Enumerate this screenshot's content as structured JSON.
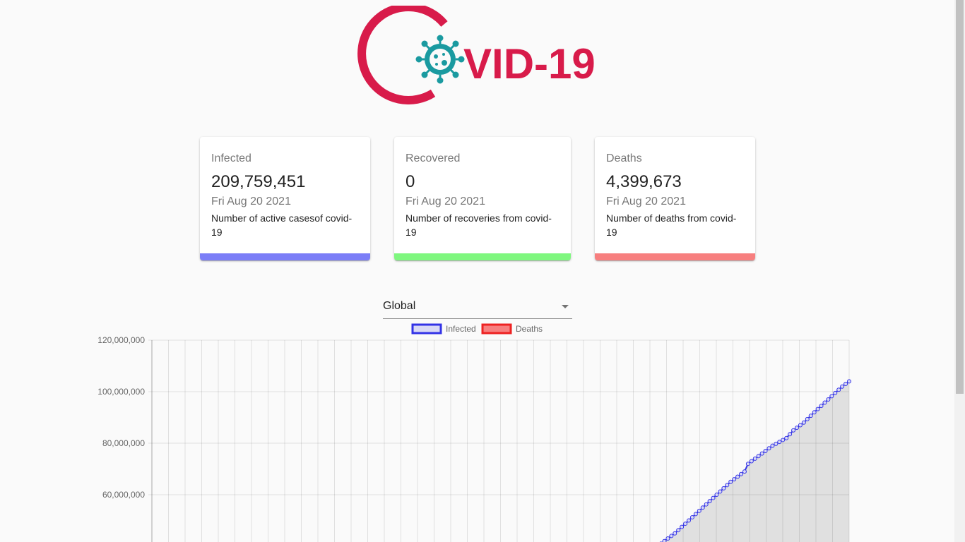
{
  "logo": {
    "text": "VID-19",
    "brand_color": "#d81b4a",
    "virus_color": "#1a9aa0"
  },
  "cards": [
    {
      "label": "Infected",
      "value": "209,759,451",
      "date": "Fri Aug 20 2021",
      "description": "Number of active casesof covid-19",
      "color": "#7b7ef7"
    },
    {
      "label": "Recovered",
      "value": "0",
      "date": "Fri Aug 20 2021",
      "description": "Number of recoveries from covid-19",
      "color": "#7ff77f"
    },
    {
      "label": "Deaths",
      "value": "4,399,673",
      "date": "Fri Aug 20 2021",
      "description": "Number of deaths from covid-19",
      "color": "#f77f7f"
    }
  ],
  "country_select": {
    "selected": "Global"
  },
  "chart_data": {
    "type": "line",
    "title": "",
    "xlabel": "",
    "ylabel": "",
    "ylim": [
      40000000,
      120000000
    ],
    "yticks": [
      "120,000,000",
      "100,000,000",
      "80,000,000",
      "60,000,000"
    ],
    "grid": true,
    "legend_position": "top",
    "series": [
      {
        "name": "Infected",
        "border_color": "#3333e6",
        "fill_color": "#d9d9f5",
        "x_fraction": [
          0.717,
          0.73,
          0.75,
          0.77,
          0.79,
          0.81,
          0.83,
          0.85,
          0.855,
          0.87,
          0.89,
          0.91,
          0.92,
          0.935,
          0.95,
          0.97,
          0.99,
          1.0
        ],
        "values": [
          40000000,
          41000000,
          45000000,
          50000000,
          55000000,
          60000000,
          65000000,
          69000000,
          72000000,
          75000000,
          79000000,
          82000000,
          85000000,
          88000000,
          92000000,
          97000000,
          102000000,
          104000000
        ]
      },
      {
        "name": "Deaths",
        "border_color": "#ee2222",
        "fill_color": "#f77f7f",
        "values": []
      }
    ]
  }
}
